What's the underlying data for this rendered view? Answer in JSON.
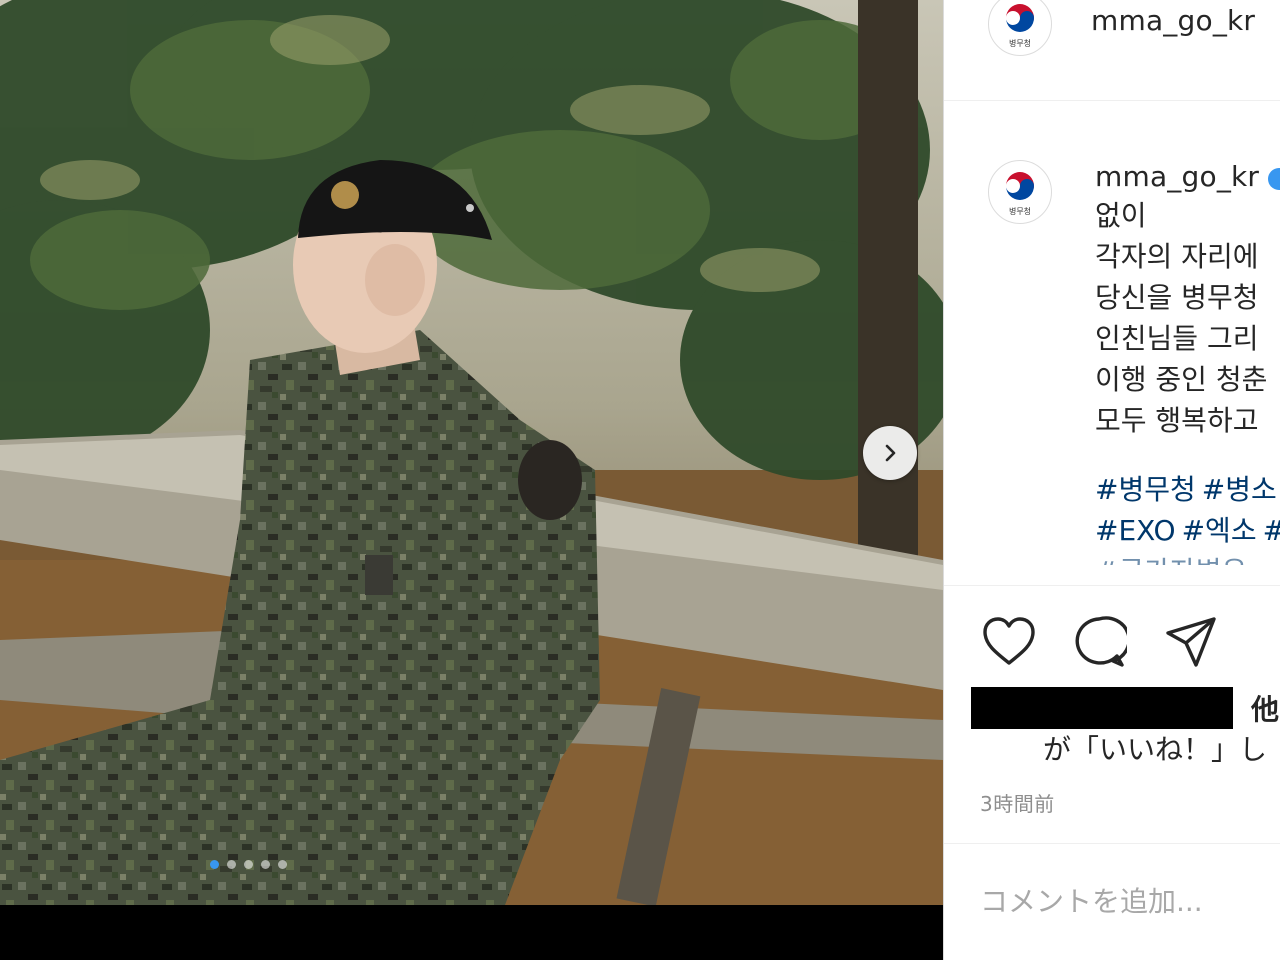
{
  "post": {
    "username": "mma_go_kr",
    "avatar_caption": "병무청",
    "caption_lines": [
      "없이",
      "각자의 자리에",
      "당신을 병무청",
      "인친님들 그리",
      "이행 중인 청춘",
      "모두 행복하고"
    ],
    "hashtags_line1": [
      "#병무청",
      "#병소"
    ],
    "hashtags_line2": [
      "#EXO",
      "#엑소",
      "#"
    ],
    "hashtags_line3": "#국가자병유",
    "likes_suffix": "他",
    "likes_line2": "が「いいね！」し",
    "time_ago": "3時間前",
    "comment_placeholder": "コメントを追加..."
  },
  "carousel": {
    "slide_count": 5,
    "active_index": 0
  },
  "icons": {
    "like": "heart-icon",
    "comment": "comment-icon",
    "share": "paper-plane-icon",
    "next": "chevron-right-icon",
    "verified": "verified-badge-icon",
    "logo": "taegeuk-logo-icon"
  },
  "colors": {
    "accent": "#3897f0",
    "text": "#262626",
    "muted": "#8e8e8e",
    "hashtag": "#00376b"
  }
}
